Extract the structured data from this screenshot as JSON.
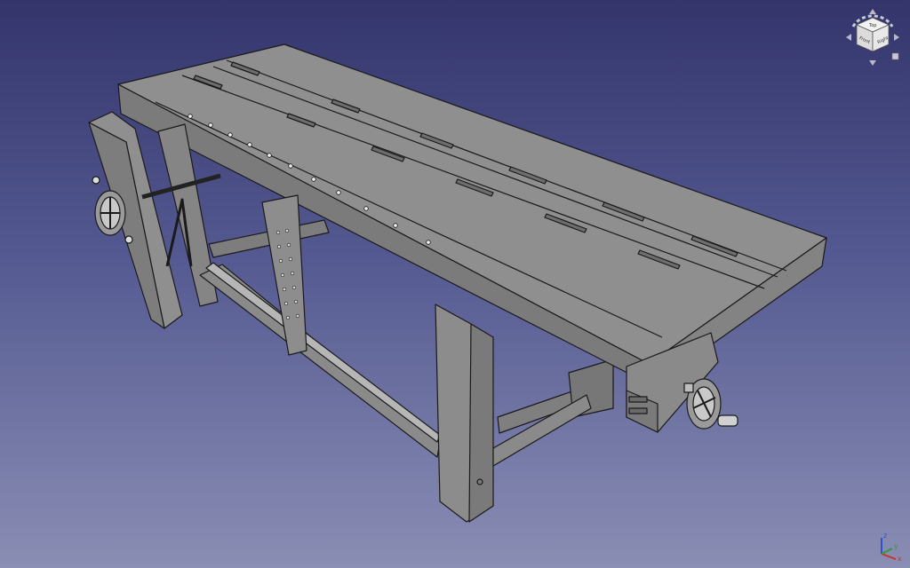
{
  "viewport": {
    "background_top": "#33356b",
    "background_bottom": "#8a8eb4",
    "model_fill": "#8c8c8c",
    "model_edge": "#1a1a1a"
  },
  "model": {
    "name": "workbench",
    "parts": [
      "bench-top",
      "front-leg",
      "back-leg-right",
      "leg-vise-chop",
      "leg-vise-handwheel",
      "end-vise-handwheel",
      "stretcher-long",
      "stretcher-short",
      "dog-holes",
      "planing-stop-slots",
      "guide-rail",
      "deadman"
    ]
  },
  "navigation_cube": {
    "faces": {
      "top": "Top",
      "front": "Front",
      "right": "Right"
    },
    "icon": "navigation-cube-icon"
  },
  "axis_triad": {
    "x": {
      "label": "x",
      "color": "#d0302c"
    },
    "y": {
      "label": "y",
      "color": "#2f9a36"
    },
    "z": {
      "label": "z",
      "color": "#2a55c8"
    }
  }
}
